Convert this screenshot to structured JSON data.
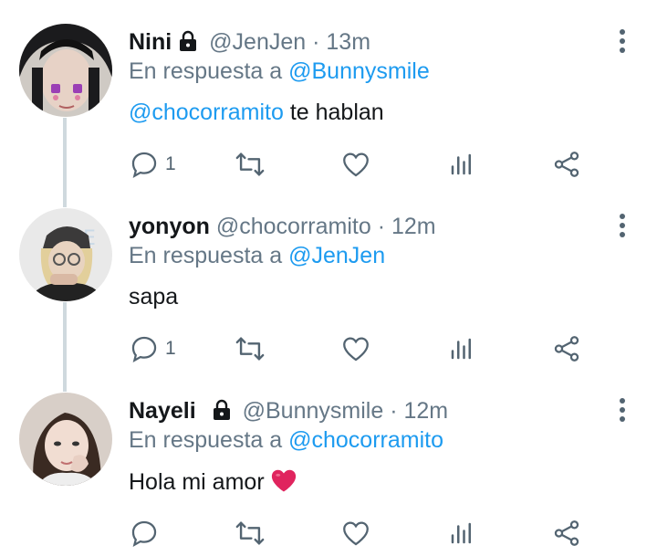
{
  "tweets": [
    {
      "name": "Nini",
      "locked": true,
      "handle": "@JenJen",
      "separator": "·",
      "time": "13m",
      "reply_prefix": "En respuesta a",
      "reply_to": "@Bunnysmile",
      "text_mention": "@chocorramito",
      "text": " te hablan",
      "reply_count": "1"
    },
    {
      "name": "yonyon",
      "locked": false,
      "handle": "@chocorramito",
      "separator": "·",
      "time": "12m",
      "reply_prefix": "En respuesta a",
      "reply_to": "@JenJen",
      "text_mention": "",
      "text": "sapa",
      "reply_count": "1"
    },
    {
      "name": "Nayeli",
      "locked": true,
      "handle": "@Bunnysmile",
      "separator": "·",
      "time": "12m",
      "reply_prefix": "En respuesta a",
      "reply_to": "@chocorramito",
      "text_mention": "",
      "text": "Hola mi amor",
      "text_emoji": "heart",
      "reply_count": ""
    }
  ],
  "colors": {
    "link": "#1d9bf0",
    "secondary": "#657786",
    "thread_line": "#cfd9de",
    "heart": "#e0245e"
  },
  "icons": [
    "reply-icon",
    "retweet-icon",
    "like-icon",
    "analytics-icon",
    "share-icon",
    "more-icon",
    "lock-icon"
  ]
}
